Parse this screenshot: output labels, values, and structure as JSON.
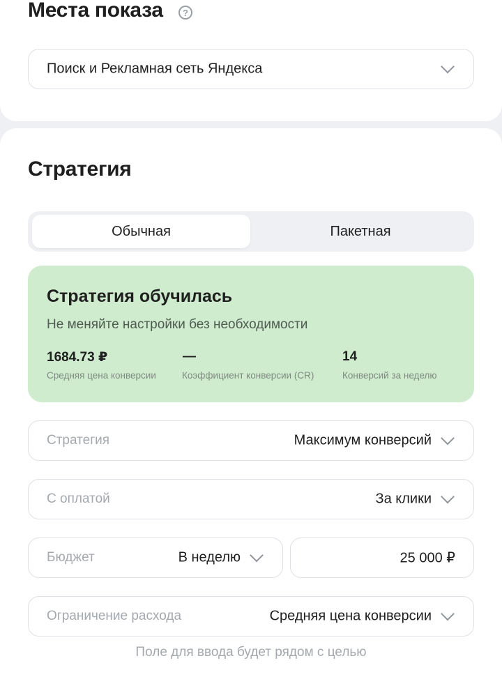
{
  "placements": {
    "title": "Места показа",
    "help_icon": "question-circle-icon",
    "select_value": "Поиск и Рекламная сеть Яндекса"
  },
  "strategy": {
    "title": "Стратегия",
    "tabs": [
      {
        "label": "Обычная",
        "active": true
      },
      {
        "label": "Пакетная",
        "active": false
      }
    ],
    "status": {
      "title": "Стратегия обучилась",
      "subtitle": "Не меняйте настройки без необходимости",
      "stats": [
        {
          "value": "1684.73 ₽",
          "label": "Средняя цена конверсии"
        },
        {
          "value": "—",
          "label": "Коэффициент конверсии (CR)"
        },
        {
          "value": "14",
          "label": "Конверсий за неделю"
        }
      ],
      "background": "#cfeccf"
    },
    "fields": {
      "strategy": {
        "label": "Стратегия",
        "value": "Максимум конверсий"
      },
      "payment": {
        "label": "С оплатой",
        "value": "За клики"
      },
      "budget": {
        "label": "Бюджет",
        "period": "В неделю",
        "amount": "25 000 ₽"
      },
      "limit": {
        "label": "Ограничение расхода",
        "value": "Средняя цена конверсии"
      }
    },
    "hint": "Поле для ввода будет рядом с целью"
  }
}
